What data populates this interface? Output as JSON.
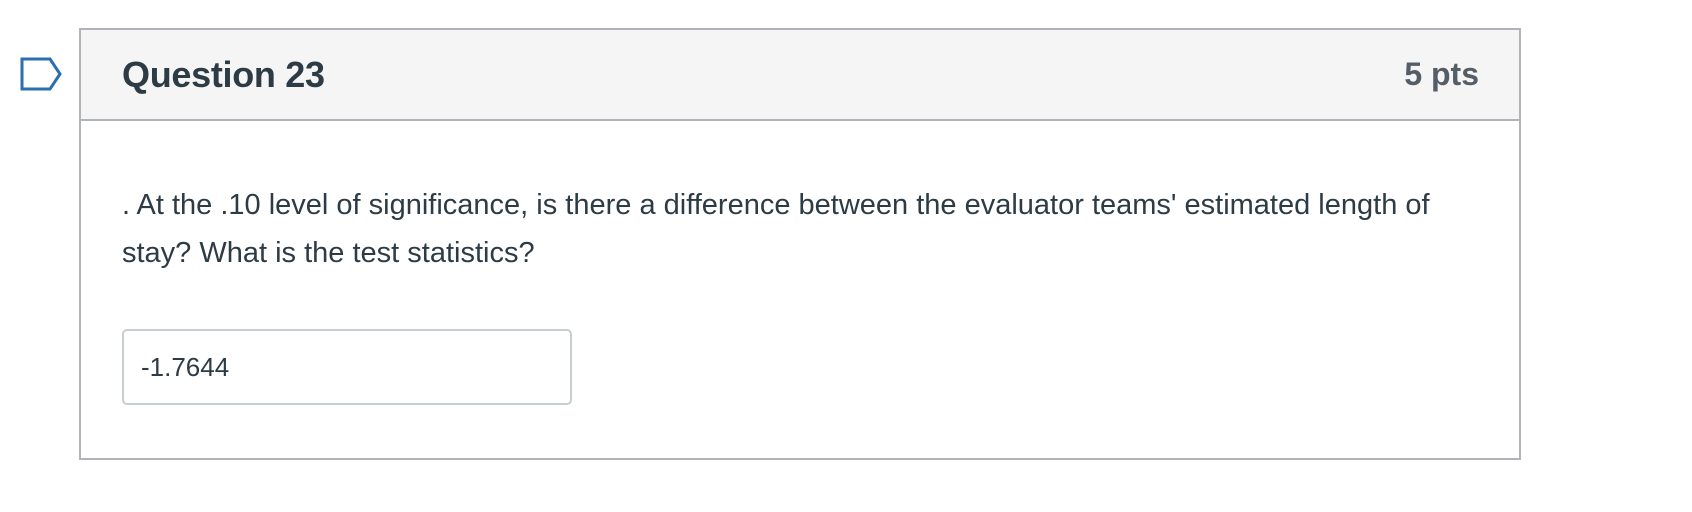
{
  "question": {
    "title": "Question 23",
    "points": "5 pts",
    "text": ". At the .10 level of significance, is there a difference between the evaluator teams' estimated length of stay? What is the test statistics?",
    "answer_value": "-1.7644"
  },
  "icons": {
    "flag": "flag-question-icon"
  },
  "colors": {
    "header_bg": "#f5f5f5",
    "border": "#b0b4b8",
    "text": "#2d3b45",
    "flag_outline": "#2a6fb0"
  }
}
